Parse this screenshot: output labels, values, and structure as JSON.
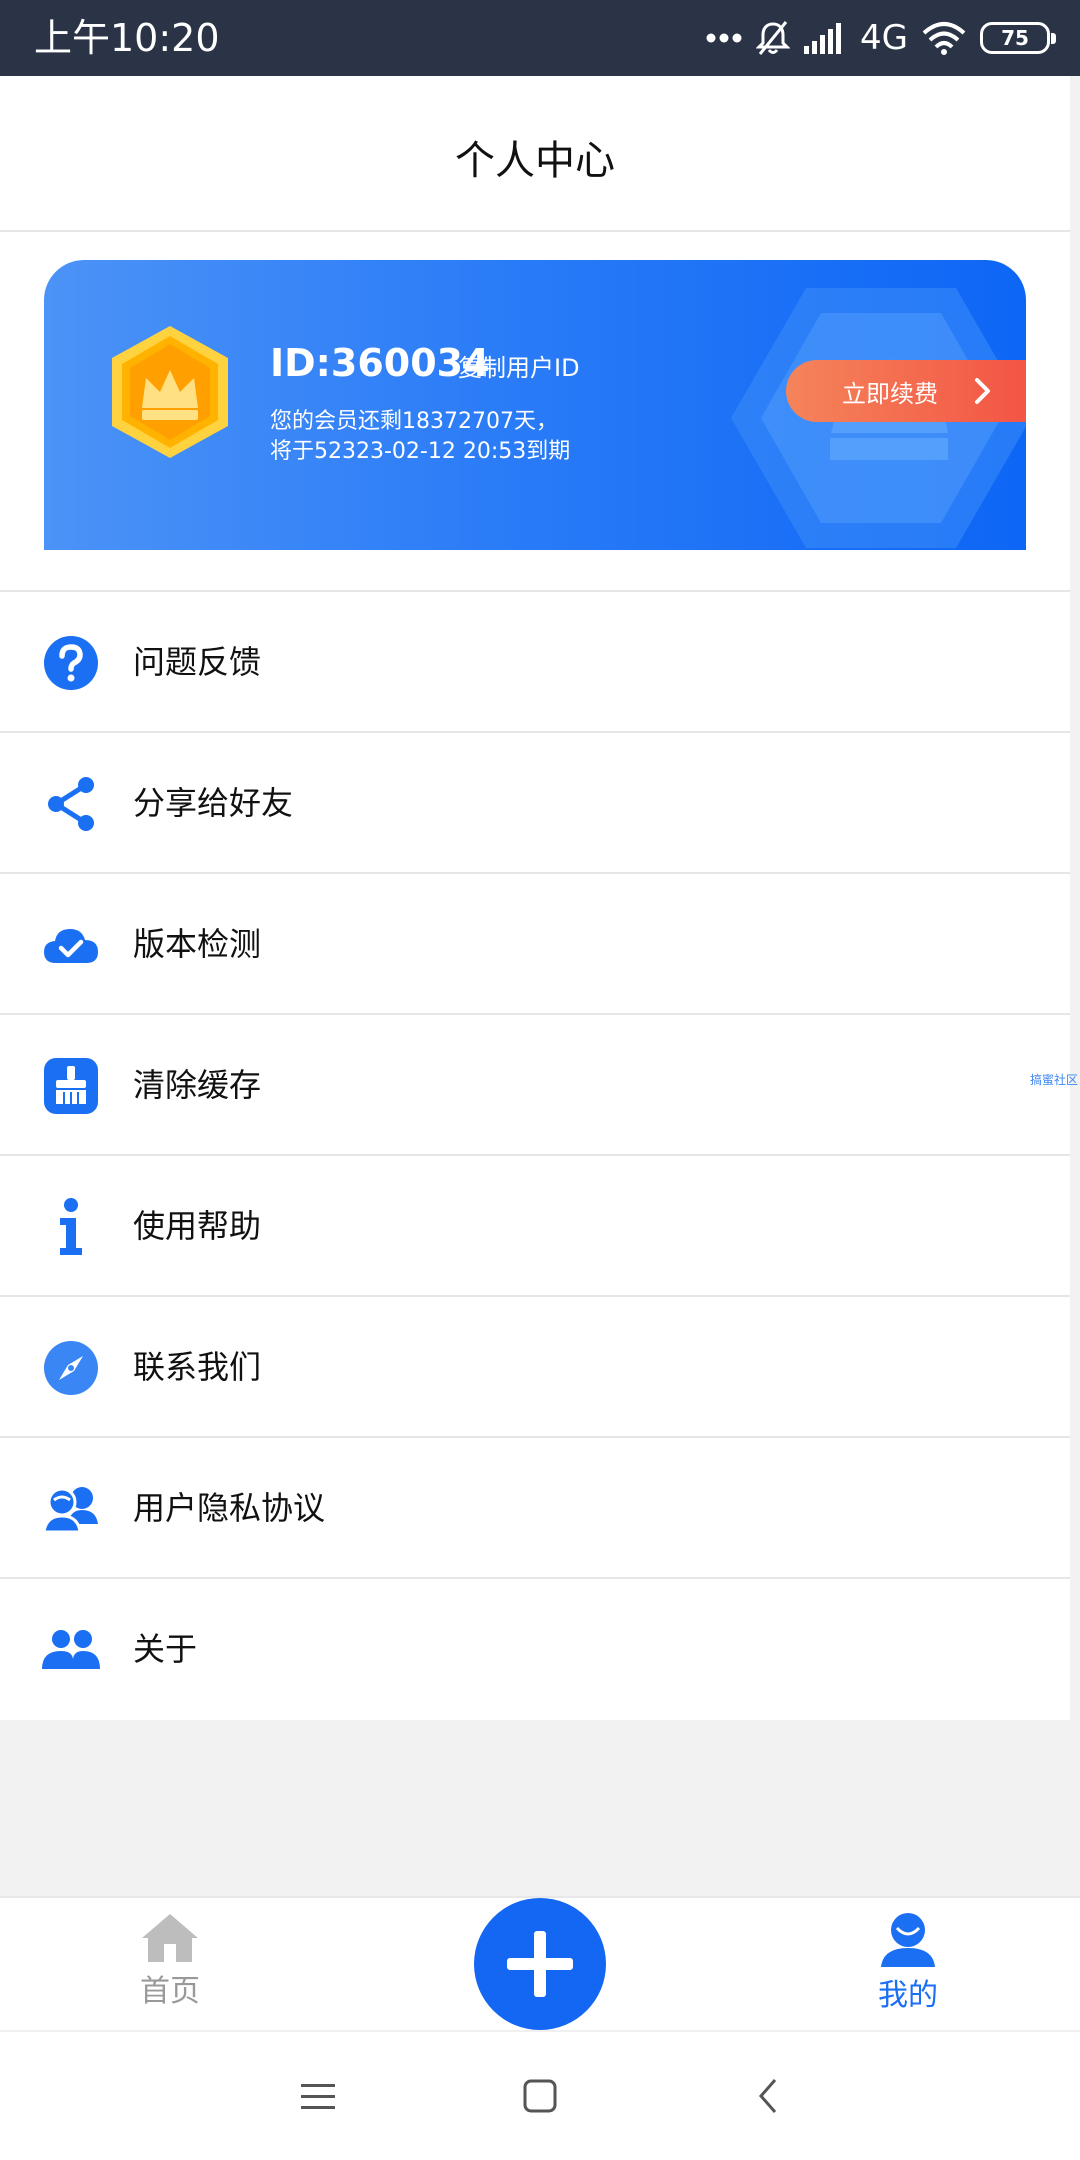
{
  "status_bar": {
    "time": "上午10:20",
    "network": "4G",
    "battery": "75",
    "bg_color": "#2b3446"
  },
  "header": {
    "title": "个人中心"
  },
  "member_card": {
    "user_id": "ID:360034",
    "copy_label": "复制用户ID",
    "remaining": "您的会员还剩18372707天，",
    "expiry": "将于52323-02-12 20:53到期",
    "renew_label": "立即续费",
    "gradient_start": "#4c93f7",
    "gradient_end": "#0d66f5"
  },
  "menu": {
    "items": [
      {
        "label": "问题反馈",
        "icon": "question-icon"
      },
      {
        "label": "分享给好友",
        "icon": "share-icon"
      },
      {
        "label": "版本检测",
        "icon": "cloud-check-icon"
      },
      {
        "label": "清除缓存",
        "icon": "broom-icon"
      },
      {
        "label": "使用帮助",
        "icon": "info-icon"
      },
      {
        "label": "联系我们",
        "icon": "compass-icon"
      },
      {
        "label": "用户隐私协议",
        "icon": "users-chat-icon"
      },
      {
        "label": "关于",
        "icon": "group-icon"
      }
    ],
    "watermark": "搞蜜社区"
  },
  "tabbar": {
    "home_label": "首页",
    "mine_label": "我的",
    "active_color": "#1a6ff2",
    "inactive_color": "#999999"
  },
  "accent_color": "#1467f2"
}
